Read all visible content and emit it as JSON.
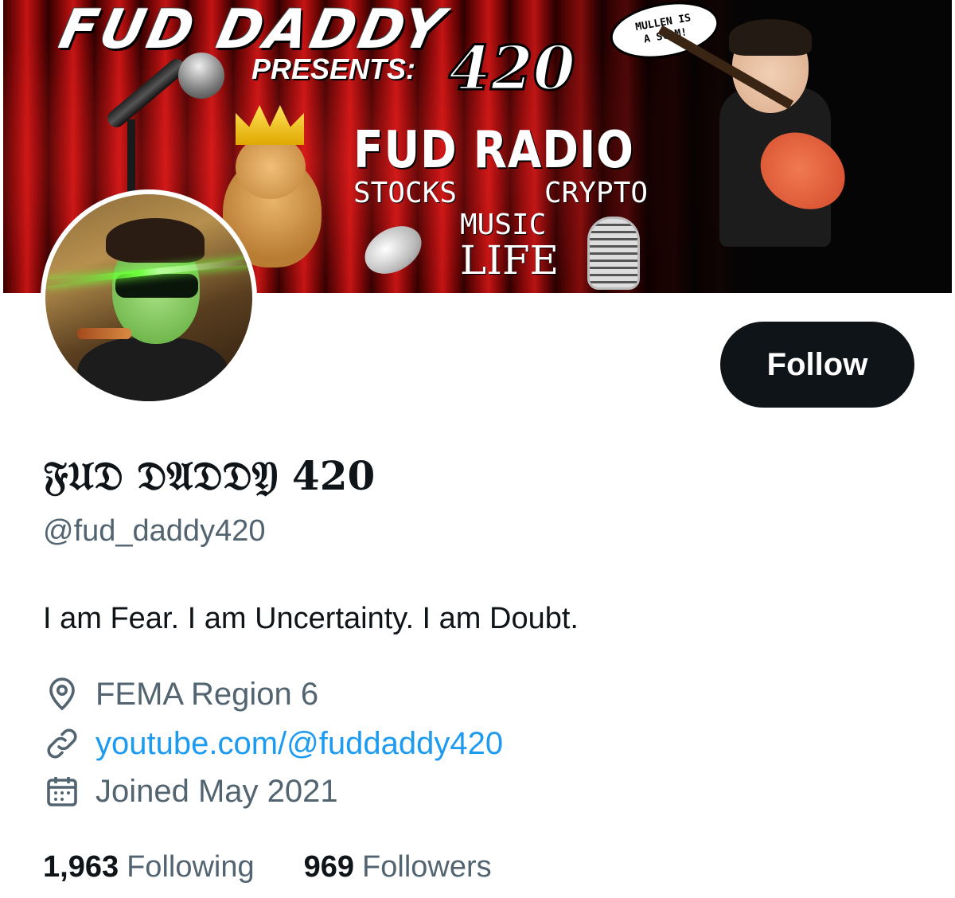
{
  "banner": {
    "title": "FUD DADDY",
    "presents": "PRESENTS:",
    "number": "420",
    "speech_line1": "MULLEN IS",
    "speech_line2": "A SCAM!",
    "radio_title": "FUD RADIO",
    "word_stocks": "STOCKS",
    "word_crypto": "CRYPTO",
    "word_music": "MUSIC",
    "word_life": "LIFE"
  },
  "profile": {
    "display_name": "𝔉𝔘𝔇 𝔇𝔄𝔇𝔇𝔜 420",
    "handle": "@fud_daddy420",
    "bio": "I am Fear. I am Uncertainty. I am Doubt.",
    "location": "FEMA Region 6",
    "link": "youtube.com/@fuddaddy420",
    "joined": "Joined May 2021"
  },
  "actions": {
    "follow_label": "Follow"
  },
  "stats": {
    "following_count": "1,963",
    "following_label": "Following",
    "followers_count": "969",
    "followers_label": "Followers"
  },
  "icons": {
    "location": "location-pin-icon",
    "link": "link-icon",
    "joined": "calendar-icon"
  },
  "colors": {
    "text_primary": "#0f1419",
    "text_secondary": "#536471",
    "link": "#1d9bf0",
    "button_bg": "#0f1419"
  }
}
